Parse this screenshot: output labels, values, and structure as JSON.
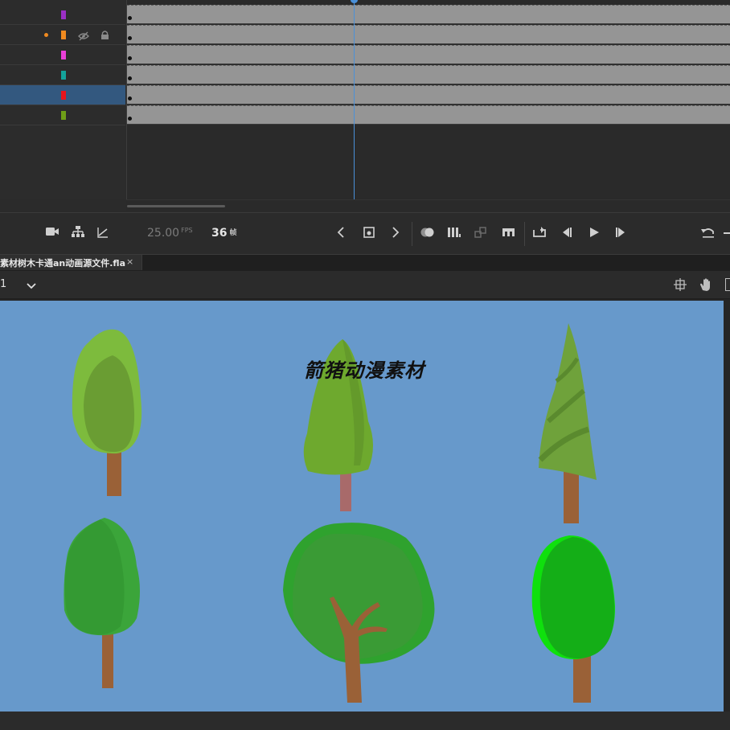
{
  "timeline": {
    "layers": [
      {
        "color": "#9b2fc4",
        "selected": false,
        "has_dot": false
      },
      {
        "color": "#f08a1f",
        "selected": false,
        "has_dot": true
      },
      {
        "color": "#ea3fd8",
        "selected": false,
        "has_dot": false
      },
      {
        "color": "#13a39b",
        "selected": false,
        "has_dot": false
      },
      {
        "color": "#e8141b",
        "selected": true,
        "has_dot": false
      },
      {
        "color": "#6e9e17",
        "selected": false,
        "has_dot": false
      }
    ],
    "fps_value": "25.00",
    "fps_unit": "FPS",
    "current_frame": "36",
    "frame_unit": "帧"
  },
  "document": {
    "tab_label": "素材树木卡通an动画源文件.fla",
    "close_glyph": "×",
    "scene_number": "1",
    "scene_chevron": "⌄"
  },
  "stage": {
    "background": "#6799cb",
    "title": "箭猪动漫素材"
  },
  "icons": {
    "camera": "camera-icon",
    "layer_parent": "layer-parenting-icon",
    "graph": "graph-icon",
    "prev": "chevron-left-icon",
    "insert_keyframe": "insert-keyframe-icon",
    "next": "chevron-right-icon",
    "onion_skin": "onion-skin-icon",
    "edit_multiple": "edit-multiple-frames-icon",
    "snap": "snap-icon",
    "center_frame": "center-frame-icon",
    "loop": "loop-icon",
    "step_back": "step-back-icon",
    "play": "play-icon",
    "step_forward": "step-forward-icon",
    "undo": "undo-icon",
    "align_stage": "center-stage-icon",
    "hand": "hand-tool-icon"
  }
}
